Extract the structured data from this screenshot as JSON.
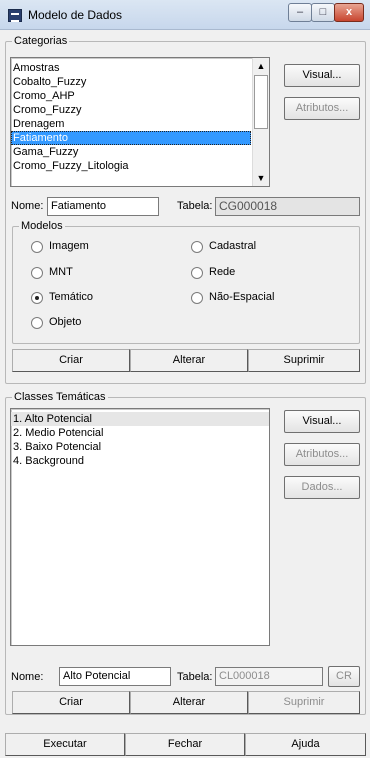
{
  "window": {
    "title": "Modelo de Dados",
    "buttons": {
      "minimize": "–",
      "maximize": "□",
      "close": "x"
    }
  },
  "categorias": {
    "group_label": "Categorias",
    "items": [
      "Amostras",
      "Cobalto_Fuzzy",
      "Cromo_AHP",
      "Cromo_Fuzzy",
      "Drenagem",
      "Fatiamento",
      "Gama_Fuzzy",
      "Cromo_Fuzzy_Litologia"
    ],
    "selected": "Fatiamento",
    "visual_button": "Visual...",
    "atributos_button": "Atributos...",
    "nome_label": "Nome:",
    "nome_value": "Fatiamento",
    "tabela_label": "Tabela:",
    "tabela_value": "CG000018",
    "modelos": {
      "group_label": "Modelos",
      "options": [
        {
          "label": "Imagem",
          "checked": false
        },
        {
          "label": "Cadastral",
          "checked": false
        },
        {
          "label": "MNT",
          "checked": false
        },
        {
          "label": "Rede",
          "checked": false
        },
        {
          "label": "Temático",
          "checked": true
        },
        {
          "label": "Não-Espacial",
          "checked": false
        },
        {
          "label": "Objeto",
          "checked": false
        }
      ]
    },
    "criar_button": "Criar",
    "alterar_button": "Alterar",
    "suprimir_button": "Suprimir"
  },
  "classes": {
    "group_label": "Classes Temáticas",
    "items": [
      "1. Alto Potencial",
      "2. Medio Potencial",
      "3. Baixo Potencial",
      "4. Background"
    ],
    "selected": "1. Alto Potencial",
    "visual_button": "Visual...",
    "atributos_button": "Atributos...",
    "dados_button": "Dados...",
    "nome_label": "Nome:",
    "nome_value": "Alto Potencial",
    "tabela_label": "Tabela:",
    "tabela_value": "CL000018",
    "cr_button": "CR",
    "criar_button": "Criar",
    "alterar_button": "Alterar",
    "suprimir_button": "Suprimir"
  },
  "footer": {
    "executar_button": "Executar",
    "fechar_button": "Fechar",
    "ajuda_button": "Ajuda"
  }
}
